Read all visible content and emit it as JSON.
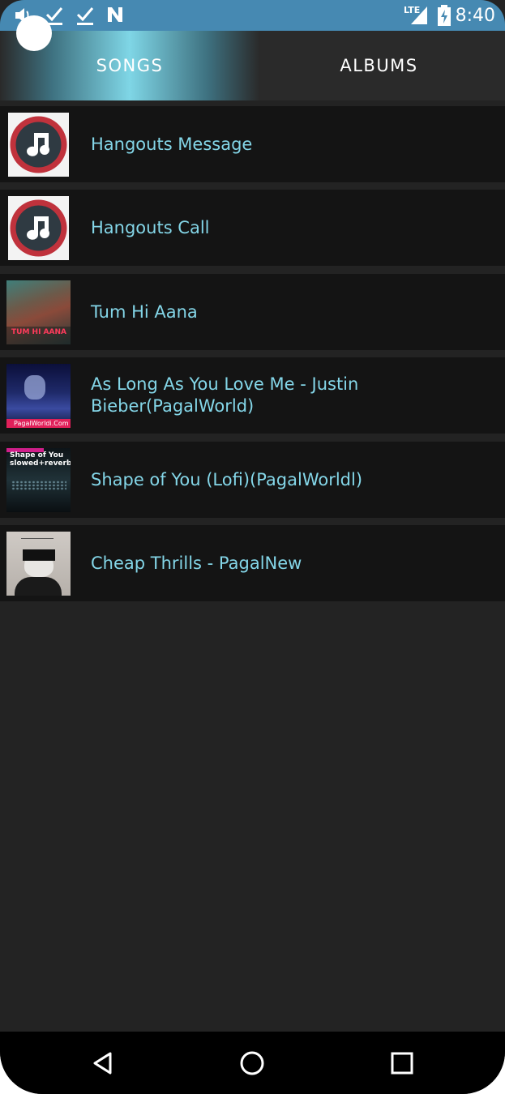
{
  "status_bar": {
    "time": "8:40",
    "network": "LTE",
    "icons": [
      "volume-icon",
      "check-icon",
      "check-icon",
      "nfc-n-icon",
      "signal-icon",
      "battery-charging-icon"
    ]
  },
  "tabs": [
    {
      "label": "SONGS",
      "selected": true
    },
    {
      "label": "ALBUMS",
      "selected": false
    }
  ],
  "songs": [
    {
      "title": "Hangouts Message",
      "art": "music-note-icon"
    },
    {
      "title": "Hangouts Call",
      "art": "music-note-icon"
    },
    {
      "title": "Tum Hi Aana",
      "art": "album-art",
      "art_text": "TUM HI AANA"
    },
    {
      "title": "As Long As You Love Me - Justin Bieber(PagalWorld)",
      "art": "album-art",
      "art_text": "PagalWorldi.Com"
    },
    {
      "title": "Shape of You (Lofi)(PagalWorldl)",
      "art": "album-art",
      "art_text": "Shape of You slowed+reverb"
    },
    {
      "title": "Cheap Thrills - PagalNew",
      "art": "album-art",
      "art_text": ""
    }
  ],
  "nav": {
    "back": "back-icon",
    "home": "home-icon",
    "recents": "recents-icon"
  },
  "colors": {
    "status_bar": "#4689b2",
    "accent_text": "#84d6e8",
    "row_bg": "#141414",
    "page_bg": "#232323"
  }
}
